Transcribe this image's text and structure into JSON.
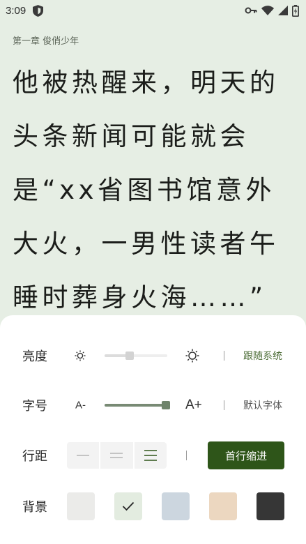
{
  "status_bar": {
    "time": "3:09",
    "icons": [
      "shield-icon",
      "vpn-key-icon",
      "wifi-icon",
      "signal-icon",
      "battery-charging-icon"
    ]
  },
  "reader": {
    "chapter_title": "第一章 俊俏少年",
    "paragraph": "他被热醒来，明天的头条新闻可能就会是“xx省图书馆意外大火，一男性读者午睡时葬身火海……”"
  },
  "settings": {
    "brightness": {
      "label": "亮度",
      "value": 0.4,
      "follow_system_label": "跟随系统",
      "follow_system_color": "#4a6b34"
    },
    "font_size": {
      "label": "字号",
      "value": 1.0,
      "small_label": "A-",
      "large_label": "A+",
      "default_font_label": "默认字体"
    },
    "line_spacing": {
      "label": "行距",
      "options": [
        "compact",
        "normal",
        "loose"
      ],
      "selected": "loose",
      "indent_button_label": "首行缩进",
      "indent_button_color": "#2e5519"
    },
    "background": {
      "label": "背景",
      "swatches": [
        {
          "name": "light-gray",
          "color": "#ebebe9",
          "selected": false
        },
        {
          "name": "pale-green",
          "color": "#e3ece0",
          "selected": true
        },
        {
          "name": "blue-gray",
          "color": "#ccd6df",
          "selected": false
        },
        {
          "name": "beige",
          "color": "#ecd7c0",
          "selected": false
        },
        {
          "name": "dark",
          "color": "#363636",
          "selected": false
        }
      ]
    }
  },
  "colors": {
    "page_background": "#e6eee4",
    "accent": "#2e5519"
  }
}
